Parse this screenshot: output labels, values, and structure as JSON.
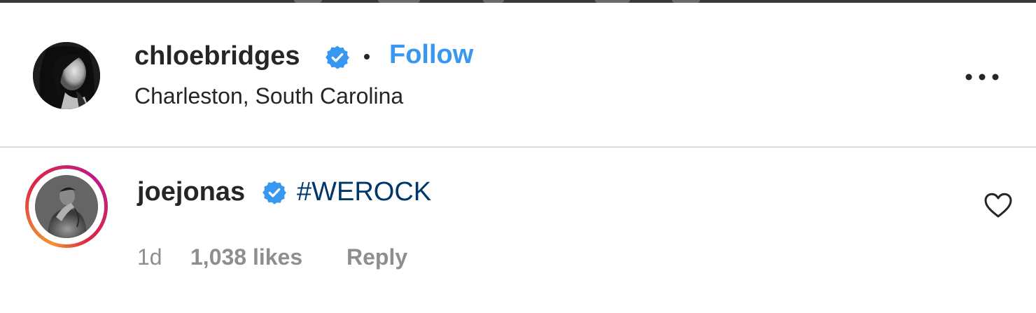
{
  "post": {
    "author": {
      "username": "chloebridges",
      "verified": true,
      "follow_label": "Follow",
      "location": "Charleston, South Carolina"
    },
    "more_options_icon": "ellipsis-icon"
  },
  "comment": {
    "username": "joejonas",
    "verified": true,
    "has_story": true,
    "text": "#WEROCK",
    "timestamp": "1d",
    "likes": "1,038 likes",
    "reply_label": "Reply",
    "like_icon": "heart-outline-icon"
  },
  "colors": {
    "text": "#262626",
    "secondary_text": "#8e8e8e",
    "follow_blue": "#3897f0",
    "verified_blue": "#3897f0",
    "hashtag": "#00376b",
    "divider": "#dbdbdb"
  }
}
